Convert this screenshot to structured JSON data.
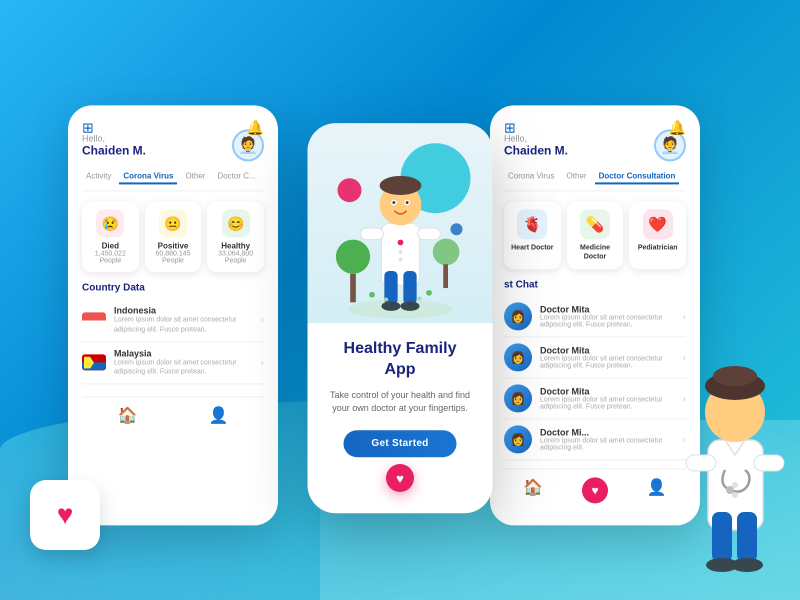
{
  "app": {
    "title": "Healthy Family APP",
    "tagline": "Take control of your health and find your own doctor at your fingertips.",
    "get_started": "Get Started"
  },
  "left_phone": {
    "greeting": "Hello,",
    "user": "Chaiden M.",
    "tabs": [
      "Activity",
      "Corona Virus",
      "Other",
      "Doctor C..."
    ],
    "active_tab": "Corona Virus",
    "stats": [
      {
        "label": "Died",
        "count": "1,450,022 People",
        "icon": "😢",
        "color": "#ffebee"
      },
      {
        "label": "Positive",
        "count": "60,880,145 People",
        "icon": "😐",
        "color": "#fff8e1"
      },
      {
        "label": "Healthy",
        "count": "33,064,800 People",
        "icon": "😊",
        "color": "#e8f5e9"
      }
    ],
    "country_section": "Country Data",
    "countries": [
      {
        "name": "Indonesia",
        "desc": "Lorem ipsum dolor sit amet consectetur adipiscing elit. Fusce pretean.",
        "flag_color": "#ef5350"
      },
      {
        "name": "Malaysia",
        "desc": "Lorem ipsum dolor sit amet consectetur adipiscing elit. Fusce pretean.",
        "flag_color": "#1565c0"
      }
    ]
  },
  "right_phone": {
    "greeting": "Hello,",
    "user": "Chaiden M.",
    "tabs": [
      "Corona Virus",
      "Other",
      "Doctor Consultation"
    ],
    "active_tab": "Doctor Consultation",
    "doctors": [
      {
        "name": "Heart Doctor",
        "icon": "🫀",
        "color": "#e3f2fd"
      },
      {
        "name": "Medicine Doctor",
        "icon": "💊",
        "color": "#e8f5e9"
      },
      {
        "name": "Pediatrician",
        "icon": "❤️",
        "color": "#fce4ec"
      }
    ],
    "chat_section": "st Chat",
    "chats": [
      {
        "name": "Doctor Mita",
        "msg": "Lorem ipsum dolor sit amet consectetur adipiscing elit. Fusce pretean.",
        "avatar": "👩‍⚕️"
      },
      {
        "name": "Doctor Mita",
        "msg": "Lorem ipsum dolor sit amet consectetur adipiscing elit. Fusce pretean.",
        "avatar": "👩‍⚕️"
      },
      {
        "name": "Doctor Mita",
        "msg": "Lorem ipsum dolor sit amet consectetur adipiscing elit. Fusce pretean.",
        "avatar": "👩‍⚕️"
      },
      {
        "name": "Doctor Mi...",
        "msg": "Lorem ipsum dolor sit amet consectetur adipiscing elit.",
        "avatar": "👩‍⚕️"
      }
    ]
  },
  "center_phone": {
    "heading_line1": "Healthy Family",
    "heading_line2": "App",
    "tagline": "Take control of your health and find your own doctor at your fingertips.",
    "cta": "Get Started"
  },
  "icons": {
    "grid": "⊞",
    "bell": "🔔",
    "home": "🏠",
    "person": "👤",
    "heart": "♥"
  }
}
